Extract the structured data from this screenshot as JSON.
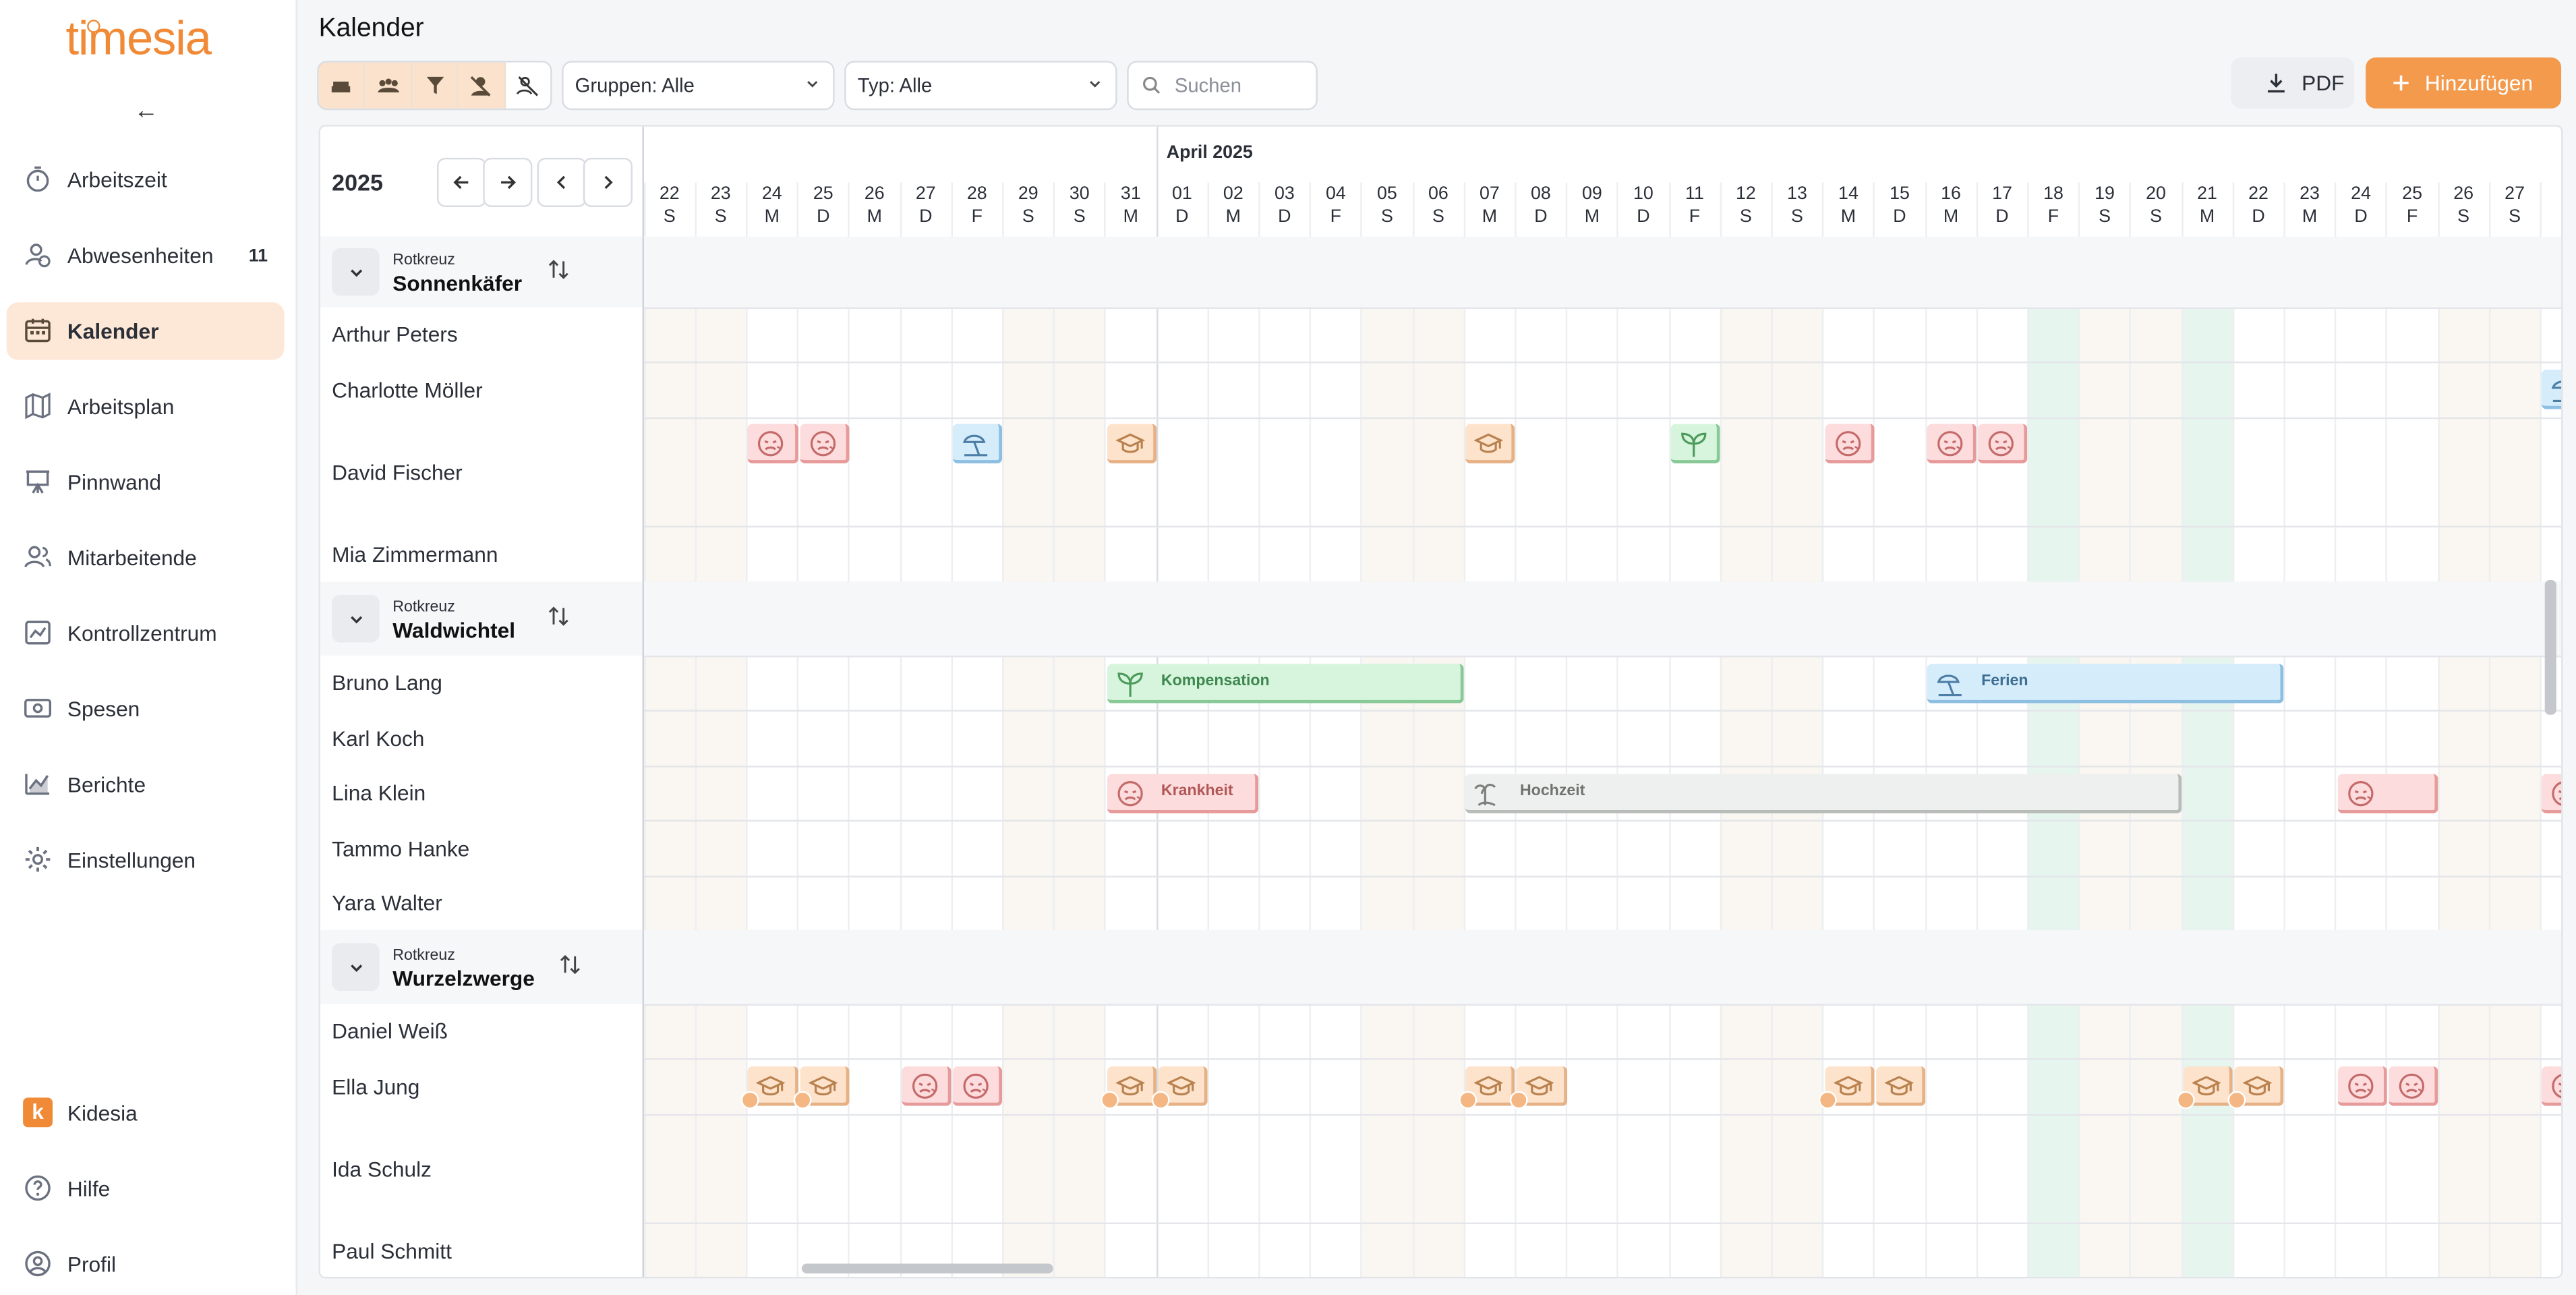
{
  "app": {
    "logo": "timesia"
  },
  "sidebar": {
    "items": [
      {
        "label": "Arbeitszeit",
        "icon": "stopwatch-icon",
        "active": false,
        "badge": ""
      },
      {
        "label": "Abwesenheiten",
        "icon": "absence-user-icon",
        "active": false,
        "badge": "11"
      },
      {
        "label": "Kalender",
        "icon": "calendar-icon",
        "active": true,
        "badge": ""
      },
      {
        "label": "Arbeitsplan",
        "icon": "map-icon",
        "active": false,
        "badge": ""
      },
      {
        "label": "Pinnwand",
        "icon": "presentation-board-icon",
        "active": false,
        "badge": ""
      },
      {
        "label": "Mitarbeitende",
        "icon": "users-icon",
        "active": false,
        "badge": ""
      },
      {
        "label": "Kontrollzentrum",
        "icon": "dashboard-icon",
        "active": false,
        "badge": ""
      },
      {
        "label": "Spesen",
        "icon": "money-icon",
        "active": false,
        "badge": ""
      },
      {
        "label": "Berichte",
        "icon": "chart-icon",
        "active": false,
        "badge": ""
      },
      {
        "label": "Einstellungen",
        "icon": "gear-icon",
        "active": false,
        "badge": ""
      }
    ],
    "bottom": [
      {
        "label": "Kidesia",
        "icon": "kidesia-logo-icon"
      },
      {
        "label": "Hilfe",
        "icon": "help-icon"
      },
      {
        "label": "Profil",
        "icon": "profile-icon"
      }
    ],
    "kidesia_letter": "k"
  },
  "header": {
    "title": "Kalender",
    "group_filter": "Gruppen: Alle",
    "type_filter": "Typ: Alle",
    "search_placeholder": "Suchen",
    "pdf_label": "PDF",
    "add_label": "Hinzufügen"
  },
  "calendar": {
    "year": "2025",
    "month_label": "April 2025",
    "days": [
      {
        "d": "22",
        "w": "S",
        "kind": "weekend"
      },
      {
        "d": "23",
        "w": "S",
        "kind": "weekend"
      },
      {
        "d": "24",
        "w": "M",
        "kind": ""
      },
      {
        "d": "25",
        "w": "D",
        "kind": ""
      },
      {
        "d": "26",
        "w": "M",
        "kind": ""
      },
      {
        "d": "27",
        "w": "D",
        "kind": ""
      },
      {
        "d": "28",
        "w": "F",
        "kind": ""
      },
      {
        "d": "29",
        "w": "S",
        "kind": "weekend"
      },
      {
        "d": "30",
        "w": "S",
        "kind": "weekend"
      },
      {
        "d": "31",
        "w": "M",
        "kind": ""
      },
      {
        "d": "01",
        "w": "D",
        "kind": ""
      },
      {
        "d": "02",
        "w": "M",
        "kind": ""
      },
      {
        "d": "03",
        "w": "D",
        "kind": ""
      },
      {
        "d": "04",
        "w": "F",
        "kind": ""
      },
      {
        "d": "05",
        "w": "S",
        "kind": "weekend"
      },
      {
        "d": "06",
        "w": "S",
        "kind": "weekend"
      },
      {
        "d": "07",
        "w": "M",
        "kind": ""
      },
      {
        "d": "08",
        "w": "D",
        "kind": ""
      },
      {
        "d": "09",
        "w": "M",
        "kind": ""
      },
      {
        "d": "10",
        "w": "D",
        "kind": ""
      },
      {
        "d": "11",
        "w": "F",
        "kind": ""
      },
      {
        "d": "12",
        "w": "S",
        "kind": "weekend"
      },
      {
        "d": "13",
        "w": "S",
        "kind": "weekend"
      },
      {
        "d": "14",
        "w": "M",
        "kind": ""
      },
      {
        "d": "15",
        "w": "D",
        "kind": ""
      },
      {
        "d": "16",
        "w": "M",
        "kind": ""
      },
      {
        "d": "17",
        "w": "D",
        "kind": ""
      },
      {
        "d": "18",
        "w": "F",
        "kind": "holiday"
      },
      {
        "d": "19",
        "w": "S",
        "kind": "weekend"
      },
      {
        "d": "20",
        "w": "S",
        "kind": "weekend"
      },
      {
        "d": "21",
        "w": "M",
        "kind": "holiday"
      },
      {
        "d": "22",
        "w": "D",
        "kind": ""
      },
      {
        "d": "23",
        "w": "M",
        "kind": ""
      },
      {
        "d": "24",
        "w": "D",
        "kind": ""
      },
      {
        "d": "25",
        "w": "F",
        "kind": ""
      },
      {
        "d": "26",
        "w": "S",
        "kind": "weekend"
      },
      {
        "d": "27",
        "w": "S",
        "kind": "weekend"
      }
    ],
    "month_start_index": 10,
    "rows": [
      {
        "type": "group",
        "org": "Rotkreuz",
        "name": "Sonnenkäfer",
        "h": 43
      },
      {
        "type": "person",
        "name": "Arthur Peters",
        "h": 33,
        "events": []
      },
      {
        "type": "person",
        "name": "Charlotte Möller",
        "h": 34,
        "events": [
          {
            "kind": "vac",
            "start": 37,
            "span": 1,
            "label": ""
          }
        ]
      },
      {
        "type": "person",
        "name": "David Fischer",
        "h": 66,
        "events": [
          {
            "kind": "sick",
            "start": 2,
            "span": 1,
            "label": ""
          },
          {
            "kind": "sick",
            "start": 3,
            "span": 1,
            "label": ""
          },
          {
            "kind": "vac",
            "start": 6,
            "span": 1,
            "label": ""
          },
          {
            "kind": "edu",
            "start": 9,
            "span": 1,
            "label": ""
          },
          {
            "kind": "edu",
            "start": 16,
            "span": 1,
            "label": ""
          },
          {
            "kind": "comp",
            "start": 20,
            "span": 1,
            "label": ""
          },
          {
            "kind": "sick",
            "start": 23,
            "span": 1,
            "label": ""
          },
          {
            "kind": "sick",
            "start": 25,
            "span": 1,
            "label": ""
          },
          {
            "kind": "sick",
            "start": 26,
            "span": 1,
            "label": ""
          }
        ]
      },
      {
        "type": "person",
        "name": "Mia Zimmermann",
        "h": 34,
        "events": []
      },
      {
        "type": "group",
        "org": "Rotkreuz",
        "name": "Waldwichtel",
        "h": 45
      },
      {
        "type": "person",
        "name": "Bruno Lang",
        "h": 33,
        "events": [
          {
            "kind": "comp",
            "start": 9,
            "span": 7,
            "label": "Kompensation"
          },
          {
            "kind": "vac",
            "start": 25,
            "span": 7,
            "label": "Ferien"
          }
        ]
      },
      {
        "type": "person",
        "name": "Karl Koch",
        "h": 34,
        "events": []
      },
      {
        "type": "person",
        "name": "Lina Klein",
        "h": 33,
        "events": [
          {
            "kind": "sick",
            "start": 9,
            "span": 3,
            "label": "Krankheit"
          },
          {
            "kind": "wed",
            "start": 16,
            "span": 14,
            "label": "Hochzeit"
          },
          {
            "kind": "sick",
            "start": 33,
            "span": 2,
            "label": ""
          },
          {
            "kind": "sick",
            "start": 37,
            "span": 1,
            "label": ""
          }
        ]
      },
      {
        "type": "person",
        "name": "Tammo Hanke",
        "h": 34,
        "events": []
      },
      {
        "type": "person",
        "name": "Yara Walter",
        "h": 33,
        "events": []
      },
      {
        "type": "group",
        "org": "Rotkreuz",
        "name": "Wurzelzwerge",
        "h": 45
      },
      {
        "type": "person",
        "name": "Daniel Weiß",
        "h": 33,
        "events": []
      },
      {
        "type": "person",
        "name": "Ella Jung",
        "h": 34,
        "events": [
          {
            "kind": "edu",
            "start": 2,
            "span": 1,
            "label": "",
            "tag": true
          },
          {
            "kind": "edu",
            "start": 3,
            "span": 1,
            "label": "",
            "tag": true
          },
          {
            "kind": "sick",
            "start": 5,
            "span": 1,
            "label": ""
          },
          {
            "kind": "sick",
            "start": 6,
            "span": 1,
            "label": ""
          },
          {
            "kind": "edu",
            "start": 9,
            "span": 1,
            "label": "",
            "tag": true
          },
          {
            "kind": "edu",
            "start": 10,
            "span": 1,
            "label": "",
            "tag": true
          },
          {
            "kind": "edu",
            "start": 16,
            "span": 1,
            "label": "",
            "tag": true
          },
          {
            "kind": "edu",
            "start": 17,
            "span": 1,
            "label": "",
            "tag": true
          },
          {
            "kind": "edu",
            "start": 23,
            "span": 1,
            "label": "",
            "tag": true
          },
          {
            "kind": "edu",
            "start": 24,
            "span": 1,
            "label": ""
          },
          {
            "kind": "edu",
            "start": 30,
            "span": 1,
            "label": "",
            "tag": true
          },
          {
            "kind": "edu",
            "start": 31,
            "span": 1,
            "label": "",
            "tag": true
          },
          {
            "kind": "sick",
            "start": 33,
            "span": 1,
            "label": ""
          },
          {
            "kind": "sick",
            "start": 34,
            "span": 1,
            "label": ""
          },
          {
            "kind": "sick",
            "start": 37,
            "span": 1,
            "label": ""
          }
        ]
      },
      {
        "type": "person",
        "name": "Ida Schulz",
        "h": 66,
        "events": []
      },
      {
        "type": "person",
        "name": "Paul Schmitt",
        "h": 34,
        "events": []
      }
    ],
    "colors": {
      "weekend": "#faf6f1",
      "holiday": "#e7f5ef",
      "accent": "#f39a4d",
      "active_nav": "#fde7d6"
    }
  }
}
